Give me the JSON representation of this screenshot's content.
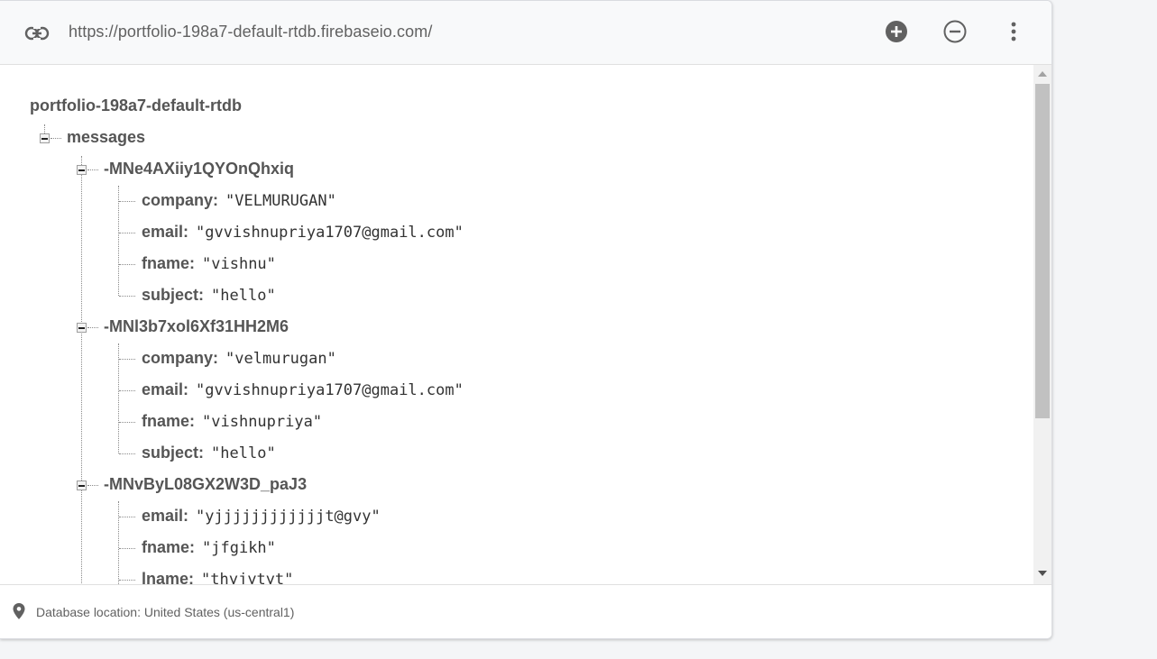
{
  "toolbar": {
    "db_url": "https://portfolio-198a7-default-rtdb.firebaseio.com/",
    "link_icon": "link-icon",
    "add_icon": "add-circle-icon",
    "remove_icon": "remove-circle-icon",
    "more_icon": "more-vert-icon"
  },
  "tree": {
    "root": "portfolio-198a7-default-rtdb",
    "messages_key": "messages",
    "records": [
      {
        "id": "-MNe4AXiiy1QYOnQhxiq",
        "fields": [
          {
            "key": "company",
            "value": "\"VELMURUGAN\""
          },
          {
            "key": "email",
            "value": "\"gvvishnupriya1707@gmail.com\""
          },
          {
            "key": "fname",
            "value": "\"vishnu\""
          },
          {
            "key": "subject",
            "value": "\"hello\""
          }
        ]
      },
      {
        "id": "-MNl3b7xol6Xf31HH2M6",
        "fields": [
          {
            "key": "company",
            "value": "\"velmurugan\""
          },
          {
            "key": "email",
            "value": "\"gvvishnupriya1707@gmail.com\""
          },
          {
            "key": "fname",
            "value": "\"vishnupriya\""
          },
          {
            "key": "subject",
            "value": "\"hello\""
          }
        ]
      },
      {
        "id": "-MNvByL08GX2W3D_paJ3",
        "fields": [
          {
            "key": "email",
            "value": "\"yjjjjjjjjjjjjt@gvy\""
          },
          {
            "key": "fname",
            "value": "\"jfgikh\""
          },
          {
            "key": "lname",
            "value": "\"thyjytyt\""
          }
        ]
      }
    ]
  },
  "footer": {
    "location_text": "Database location: United States (us-central1)",
    "pin_icon": "location-pin-icon"
  },
  "colors": {
    "text_key": "#555555",
    "text_value": "#333333",
    "icon": "#616161",
    "scroll_thumb": "#c1c1c1"
  }
}
